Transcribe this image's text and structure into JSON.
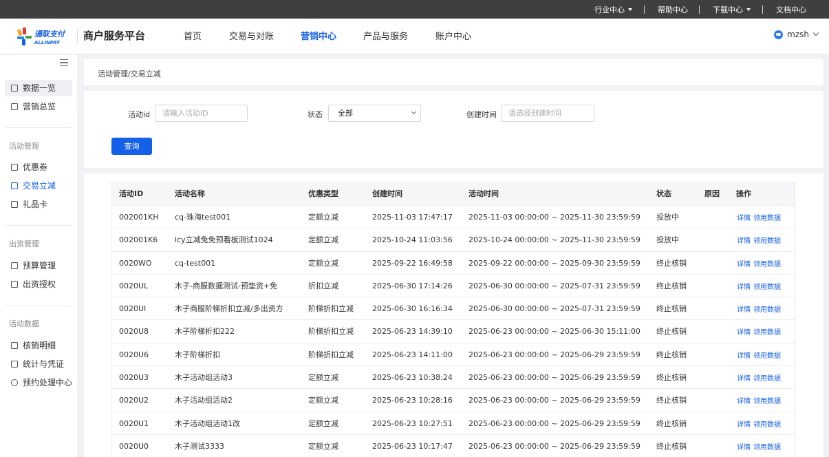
{
  "topbar": {
    "industry": "行业中心",
    "help": "帮助中心",
    "download": "下载中心",
    "docs": "文档中心"
  },
  "header": {
    "logo_text": "通联支付",
    "logo_sub": "ALLINPAY",
    "brand": "商户服务平台",
    "nav": [
      "首页",
      "交易与对账",
      "营销中心",
      "产品与服务",
      "账户中心"
    ],
    "active_nav": "营销中心",
    "user": "mzsh"
  },
  "sidebar": {
    "items_top": [
      "数据一览",
      "营销总览"
    ],
    "group_activity": "活动管理",
    "items_activity": [
      "优惠券",
      "交易立减",
      "礼品卡"
    ],
    "group_funding": "出资管理",
    "items_funding": [
      "预算管理",
      "出资授权"
    ],
    "group_data": "活动数据",
    "items_data": [
      "核销明细",
      "统计与凭证",
      "预约处理中心"
    ]
  },
  "breadcrumb": "活动管理/交易立减",
  "filter": {
    "activity_id_label": "活动id",
    "activity_id_placeholder": "请输入活动ID",
    "status_label": "状态",
    "status_value": "全部",
    "create_time_label": "创建时间",
    "create_time_placeholder": "请选择创建时间",
    "query_button": "查询"
  },
  "table": {
    "columns": [
      "活动ID",
      "活动名称",
      "优惠类型",
      "创建时间",
      "活动时间",
      "状态",
      "原因",
      "操作"
    ],
    "action_detail": "详情",
    "action_data": "领用数据",
    "rows": [
      {
        "id": "002001KH",
        "name": "cq-珠海test001",
        "type": "定额立减",
        "created": "2025-11-03 17:47:17",
        "period": "2025-11-03 00:00:00 ~ 2025-11-30 23:59:59",
        "status": "投放中",
        "reason": ""
      },
      {
        "id": "002001K6",
        "name": "lcy立减免免预看板测试1024",
        "type": "定额立减",
        "created": "2025-10-24 11:03:56",
        "period": "2025-10-24 00:00:00 ~ 2025-11-30 23:59:59",
        "status": "投放中",
        "reason": ""
      },
      {
        "id": "0020WO",
        "name": "cq-test001",
        "type": "定额立减",
        "created": "2025-09-22 16:49:58",
        "period": "2025-09-22 00:00:00 ~ 2025-09-30 23:59:59",
        "status": "终止核销",
        "reason": ""
      },
      {
        "id": "0020UL",
        "name": "木子-商服数据测试-预垫资+免",
        "type": "折扣立减",
        "created": "2025-06-30 17:14:26",
        "period": "2025-06-30 00:00:00 ~ 2025-07-31 23:59:59",
        "status": "终止核销",
        "reason": ""
      },
      {
        "id": "0020UI",
        "name": "木子商服阶梯折扣立减/多出资方",
        "type": "阶梯折扣立减",
        "created": "2025-06-30 16:16:34",
        "period": "2025-06-30 00:00:00 ~ 2025-07-31 23:59:59",
        "status": "终止核销",
        "reason": ""
      },
      {
        "id": "0020U8",
        "name": "木子阶梯折扣222",
        "type": "阶梯折扣立减",
        "created": "2025-06-23 14:39:10",
        "period": "2025-06-23 00:00:00 ~ 2025-06-30 15:11:00",
        "status": "终止核销",
        "reason": ""
      },
      {
        "id": "0020U6",
        "name": "木子阶梯折扣",
        "type": "阶梯折扣立减",
        "created": "2025-06-23 14:11:00",
        "period": "2025-06-23 00:00:00 ~ 2025-06-29 23:59:59",
        "status": "终止核销",
        "reason": ""
      },
      {
        "id": "0020U3",
        "name": "木子活动组活动3",
        "type": "定额立减",
        "created": "2025-06-23 10:38:24",
        "period": "2025-06-23 00:00:00 ~ 2025-06-29 23:59:59",
        "status": "终止核销",
        "reason": ""
      },
      {
        "id": "0020U2",
        "name": "木子活动组活动2",
        "type": "定额立减",
        "created": "2025-06-23 10:28:16",
        "period": "2025-06-23 00:00:00 ~ 2025-06-29 23:59:59",
        "status": "终止核销",
        "reason": ""
      },
      {
        "id": "0020U1",
        "name": "木子活动组活动1改",
        "type": "定额立减",
        "created": "2025-06-23 10:27:51",
        "period": "2025-06-23 00:00:00 ~ 2025-06-29 23:59:59",
        "status": "终止核销",
        "reason": ""
      },
      {
        "id": "0020U0",
        "name": "木子测试3333",
        "type": "定额立减",
        "created": "2025-06-23 10:17:47",
        "period": "2025-06-23 00:00:00 ~ 2025-06-29 23:59:59",
        "status": "终止核销",
        "reason": ""
      }
    ]
  },
  "colors": {
    "accent": "#1560e8",
    "topbar": "#3f3f3f",
    "background": "#f0f2f5"
  }
}
